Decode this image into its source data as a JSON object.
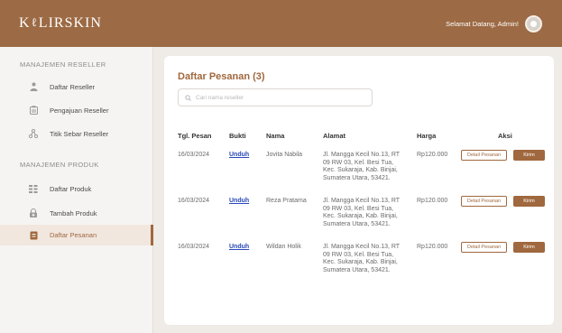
{
  "header": {
    "logo_left": "K",
    "logo_mark": "ℓ",
    "logo_right": "LIRSKIN",
    "welcome": "Selamat Datang, Admin!"
  },
  "sidebar": {
    "section_reseller": "MANAJEMEN RESELLER",
    "section_produk": "MANAJEMEN PRODUK",
    "items": [
      {
        "label": "Daftar Reseller",
        "icon": "user-icon"
      },
      {
        "label": "Pengajuan Reseller",
        "icon": "clipboard-icon"
      },
      {
        "label": "Titik Sebar Reseller",
        "icon": "share-icon"
      },
      {
        "label": "Daftar Produk",
        "icon": "grid-icon"
      },
      {
        "label": "Tambah Produk",
        "icon": "lock-plus-icon"
      },
      {
        "label": "Daftar Pesanan",
        "icon": "document-icon",
        "active": true
      }
    ]
  },
  "main": {
    "title": "Daftar Pesanan (3)",
    "search_placeholder": "Cari nama reseller",
    "columns": [
      "Tgl. Pesan",
      "Bukti",
      "Nama",
      "Alamat",
      "Harga",
      "Aksi"
    ],
    "rows": [
      {
        "date": "16/03/2024",
        "proof": "Unduh",
        "name": "Jovita Nabila",
        "address": "Jl. Mangga Kecil No.13, RT 09 RW 03, Kel. Besi Tua, Kec. Sukaraja, Kab. Binjai, Sumatera Utara, 53421.",
        "price": "Rp120.000",
        "detail": "Detail Pesanan",
        "send": "Kirim"
      },
      {
        "date": "16/03/2024",
        "proof": "Unduh",
        "name": "Reza Pratama",
        "address": "Jl. Mangga Kecil No.13, RT 09 RW 03, Kel. Besi Tua, Kec. Sukaraja, Kab. Binjai, Sumatera Utara, 53421.",
        "price": "Rp120.000",
        "detail": "Detail Pesanan",
        "send": "Kirim"
      },
      {
        "date": "16/03/2024",
        "proof": "Unduh",
        "name": "Wildan Holik",
        "address": "Jl. Mangga Kecil No.13, RT 09 RW 03, Kel. Besi Tua, Kec. Sukaraja, Kab. Binjai, Sumatera Utara, 53421.",
        "price": "Rp120.000",
        "detail": "Detail Pesanan",
        "send": "Kirim"
      }
    ]
  },
  "colors": {
    "brand": "#9c6a44",
    "accent": "#a0683e",
    "link": "#2a49b8"
  }
}
